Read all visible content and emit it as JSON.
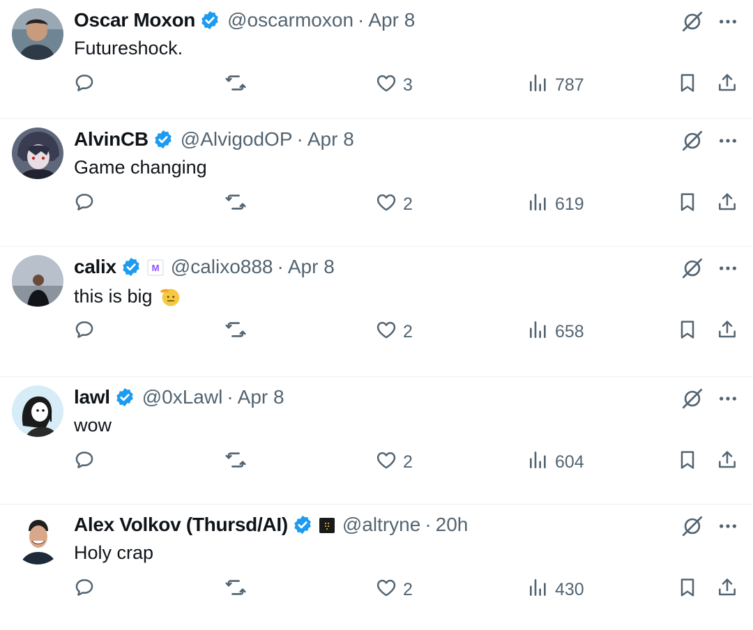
{
  "tweets": [
    {
      "name": "Oscar Moxon",
      "handle": "@oscarmoxon",
      "dot": "·",
      "time": "Apr 8",
      "text": "Futureshock.",
      "likes": "3",
      "views": "787",
      "avatar": {
        "bg": "#7c8f9c",
        "icon": "avatar-photo"
      },
      "affiliate": null
    },
    {
      "name": "AlvinCB",
      "handle": "@AlvigodOP",
      "dot": "·",
      "time": "Apr 8",
      "text": "Game changing",
      "likes": "2",
      "views": "619",
      "avatar": {
        "bg": "#6d7487",
        "icon": "avatar-anime"
      },
      "affiliate": null
    },
    {
      "name": "calix",
      "handle": "@calixo888",
      "dot": "·",
      "time": "Apr 8",
      "text": "this is big",
      "emoji": "saluting-face",
      "likes": "2",
      "views": "658",
      "avatar": {
        "bg": "#b4bcc8",
        "icon": "avatar-photo"
      },
      "affiliate": {
        "icon": "m-badge-icon",
        "letter": "M",
        "color": "#8a4fff"
      }
    },
    {
      "name": "lawl",
      "handle": "@0xLawl",
      "dot": "·",
      "time": "Apr 8",
      "text": "wow",
      "likes": "2",
      "views": "604",
      "avatar": {
        "bg": "#d6ecf7",
        "icon": "avatar-cartoon"
      },
      "affiliate": null
    },
    {
      "name": "Alex Volkov (Thursd/AI)",
      "handle": "@altryne",
      "dot": "·",
      "time": "20h",
      "text": "Holy crap",
      "likes": "2",
      "views": "430",
      "avatar": {
        "bg": "#ffffff",
        "icon": "avatar-photo"
      },
      "affiliate": {
        "icon": "dark-square-badge-icon",
        "letter": "",
        "color": "#1a1a1a"
      }
    }
  ],
  "colors": {
    "verified": "#1d9bf0",
    "text_secondary": "#536471",
    "text_primary": "#0f1419",
    "divider": "#eceff1"
  },
  "icons": {
    "reply": "reply-icon",
    "retweet": "retweet-icon",
    "like": "heart-icon",
    "views": "views-icon",
    "bookmark": "bookmark-icon",
    "share": "share-icon",
    "grok": "grok-icon",
    "more": "more-icon",
    "verified": "verified-badge-icon"
  }
}
